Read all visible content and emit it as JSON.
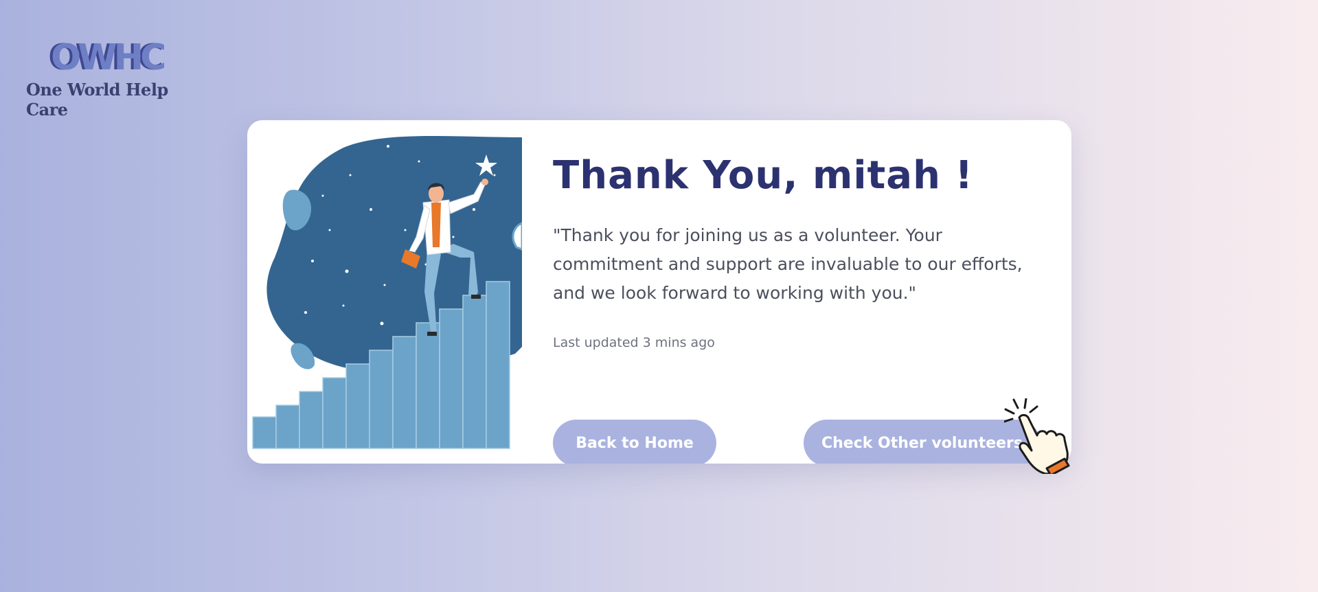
{
  "logo": {
    "mark": "OWHC",
    "name": "One World Help Care"
  },
  "card": {
    "title": "Thank You, mitah !",
    "message": "\"Thank you for joining us as a volunteer. Your commitment and support are invaluable to our efforts, and we look forward to working with you.\"",
    "updated": "Last updated 3 mins ago",
    "buttons": {
      "home": "Back to Home",
      "others": "Check Other volunteers"
    }
  },
  "colors": {
    "title": "#2c3270",
    "button": "#aab3df",
    "illustration_bg": "#336590",
    "stairs": "#6ca3c9",
    "accent": "#e8782a"
  },
  "icons": {
    "illustration": "person-climbing-stairs-illustration",
    "cursor": "hand-pointer-click-icon"
  }
}
